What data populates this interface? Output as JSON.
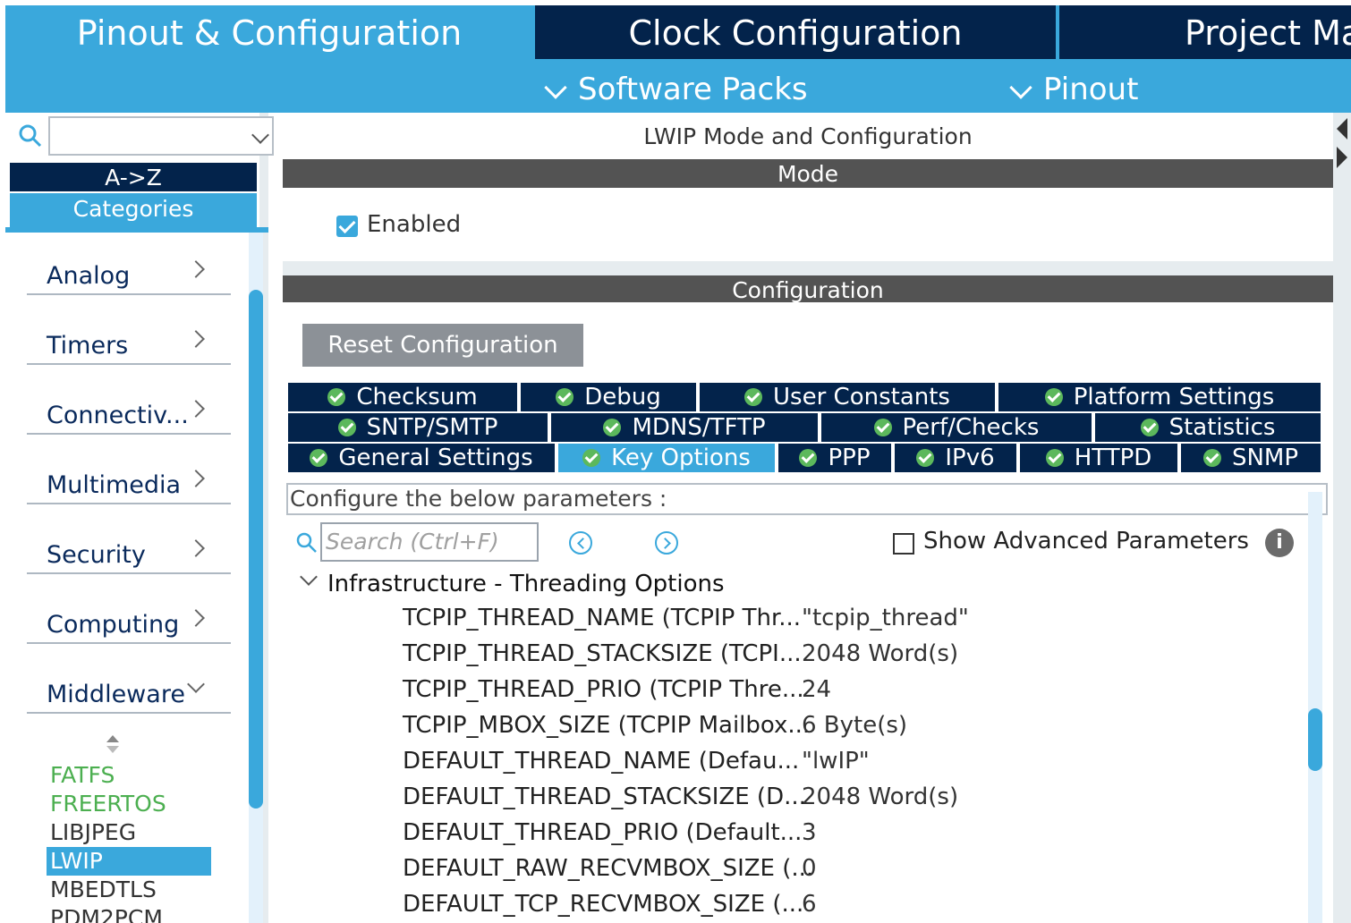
{
  "top_tabs": {
    "pinout": "Pinout & Configuration",
    "clock": "Clock Configuration",
    "project": "Project Ma"
  },
  "sub_tabs": {
    "software_packs": "Software Packs",
    "pinout": "Pinout"
  },
  "left": {
    "sort_az": "A->Z",
    "categories": "Categories",
    "category_items": [
      {
        "label": "Analog"
      },
      {
        "label": "Timers"
      },
      {
        "label": "Connectiv..."
      },
      {
        "label": "Multimedia"
      },
      {
        "label": "Security"
      },
      {
        "label": "Computing"
      },
      {
        "label": "Middleware"
      }
    ],
    "middleware_items": [
      {
        "label": "FATFS",
        "color": "#4caf50"
      },
      {
        "label": "FREERTOS",
        "color": "#4caf50"
      },
      {
        "label": "LIBJPEG",
        "color": "#333333"
      },
      {
        "label": "LWIP",
        "color": "#ffffff",
        "selected": true
      },
      {
        "label": "MBEDTLS",
        "color": "#333333"
      },
      {
        "label": "PDM2PCM",
        "color": "#333333"
      }
    ]
  },
  "right": {
    "panel_title": "LWIP Mode and Configuration",
    "mode_header": "Mode",
    "enabled_label": "Enabled",
    "enabled_checked": true,
    "config_header": "Configuration",
    "reset_button": "Reset Configuration",
    "param_tabs_row1": [
      "Checksum",
      "Debug",
      "User Constants",
      "Platform Settings"
    ],
    "param_tabs_row2": [
      "SNTP/SMTP",
      "MDNS/TFTP",
      "Perf/Checks",
      "Statistics"
    ],
    "param_tabs_row3": [
      "General Settings",
      "Key Options",
      "PPP",
      "IPv6",
      "HTTPD",
      "SNMP"
    ],
    "active_tab": "Key Options",
    "configure_label": "Configure the below parameters :",
    "search_placeholder": "Search (Ctrl+F)",
    "show_advanced_label": "Show Advanced Parameters",
    "show_advanced_checked": false,
    "info_symbol": "i",
    "group_title": "Infrastructure - Threading Options",
    "params": [
      {
        "name": "TCPIP_THREAD_NAME (TCPIP Thr...",
        "value": "\"tcpip_thread\""
      },
      {
        "name": "TCPIP_THREAD_STACKSIZE (TCPI...",
        "value": "2048 Word(s)"
      },
      {
        "name": "TCPIP_THREAD_PRIO (TCPIP Thre...",
        "value": "24"
      },
      {
        "name": "TCPIP_MBOX_SIZE (TCPIP Mailbox...",
        "value": "6 Byte(s)"
      },
      {
        "name": "DEFAULT_THREAD_NAME (Defau...",
        "value": "\"lwIP\""
      },
      {
        "name": "DEFAULT_THREAD_STACKSIZE (D...",
        "value": "2048 Word(s)"
      },
      {
        "name": "DEFAULT_THREAD_PRIO (Default...",
        "value": "3"
      },
      {
        "name": "DEFAULT_RAW_RECVMBOX_SIZE (...",
        "value": "0"
      },
      {
        "name": "DEFAULT_TCP_RECVMBOX_SIZE (...",
        "value": "6"
      }
    ]
  },
  "colors": {
    "accent": "#3aa8dc",
    "dark_navy": "#03234b",
    "header_gray": "#535353",
    "check_green": "#5cb85c"
  }
}
